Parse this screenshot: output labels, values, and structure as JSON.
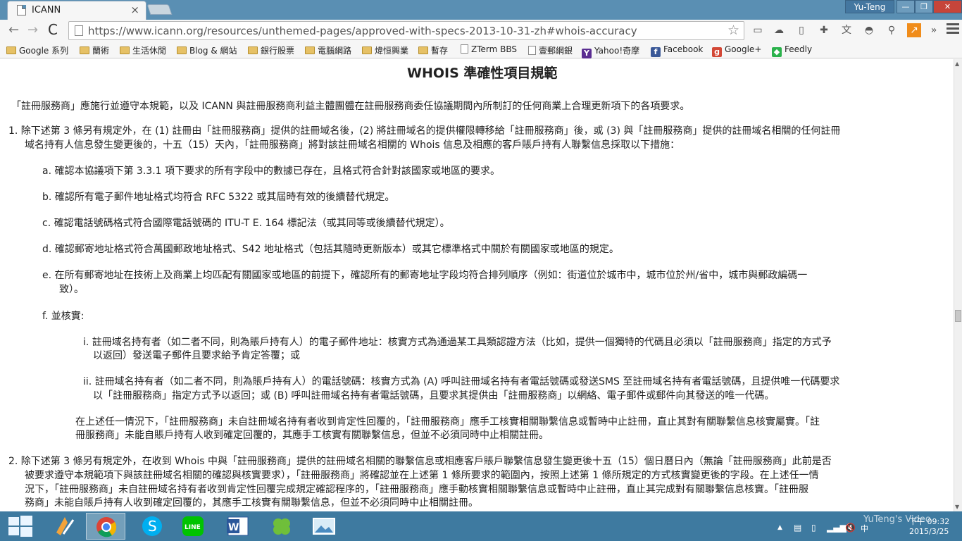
{
  "browser": {
    "tab_title": "ICANN",
    "tab_close": "×",
    "user_name": "Yu-Teng",
    "win_min": "—",
    "win_max": "❐",
    "win_close": "✕",
    "url": "https://www.icann.org/resources/unthemed-pages/approved-with-specs-2013-10-31-zh#whois-accuracy",
    "back": "←",
    "forward": "→",
    "reload": "C",
    "star": "☆"
  },
  "bookmarks": [
    {
      "label": "Google 系列",
      "kind": "folder"
    },
    {
      "label": "蘭術",
      "kind": "folder"
    },
    {
      "label": "生活休閒",
      "kind": "folder"
    },
    {
      "label": "Blog & 網站",
      "kind": "folder"
    },
    {
      "label": "銀行股票",
      "kind": "folder"
    },
    {
      "label": "電腦網路",
      "kind": "folder"
    },
    {
      "label": "煒恒興業",
      "kind": "folder"
    },
    {
      "label": "暫存",
      "kind": "folder"
    },
    {
      "label": "ZTerm BBS",
      "kind": "page"
    },
    {
      "label": "壹郵網銀",
      "kind": "page"
    },
    {
      "label": "Yahoo!奇摩",
      "kind": "yahoo"
    },
    {
      "label": "Facebook",
      "kind": "facebook"
    },
    {
      "label": "Google+",
      "kind": "gplus"
    },
    {
      "label": "Feedly",
      "kind": "feedly"
    }
  ],
  "page": {
    "title": "WHOIS 準確性項目規範",
    "intro": "「註冊服務商」應施行並遵守本規範，以及 ICANN 與註冊服務商利益主體團體在註冊服務商委任協議期間內所制訂的任何商業上合理更新項下的各項要求。",
    "item1_line1": "1. 除下述第 3 條另有規定外，在 (1) 註冊由「註冊服務商」提供的註冊域名後，(2) 將註冊域名的提供權限轉移給「註冊服務商」後，或 (3) 與「註冊服務商」提供的註冊域名相關的任何註冊",
    "item1_line2": "域名持有人信息發生變更後的，十五（15）天內，「註冊服務商」將對該註冊域名相關的 Whois 信息及相應的客戶賬戶持有人聯繫信息採取以下措施：",
    "item_a": "a. 確認本協議項下第 3.3.1 項下要求的所有字段中的數據已存在，且格式符合針對該國家或地區的要求。",
    "item_b": "b. 確認所有電子郵件地址格式均符合 RFC 5322 或其屆時有效的後續替代規定。",
    "item_c": "c. 確認電話號碼格式符合國際電話號碼的 ITU-T E. 164 標記法（或其同等或後續替代規定）。",
    "item_d": "d. 確認郵寄地址格式符合萬國郵政地址格式、S42 地址格式（包括其隨時更新版本）或其它標準格式中關於有關國家或地區的規定。",
    "item_e_line1": "e. 在所有郵寄地址在技術上及商業上均匹配有關國家或地區的前提下，確認所有的郵寄地址字段均符合排列順序（例如：街道位於城市中，城市位於州/省中，城市與郵政編碼一",
    "item_e_line2": "致）。",
    "item_f": "f. 並核實:",
    "item_fi_line1": "i. 註冊域名持有者（如二者不同，則為賬戶持有人）的電子郵件地址：核實方式為通過某工具類認證方法（比如，提供一個獨特的代碼且必須以「註冊服務商」指定的方式予",
    "item_fi_line2": "以返回）發送電子郵件且要求給予肯定答覆；或",
    "item_fii_line1": "ii. 註冊域名持有者（如二者不同，則為賬戶持有人）的電話號碼：核實方式為 (A) 呼叫註冊域名持有者電話號碼或發送SMS 至註冊域名持有者電話號碼，且提供唯一代碼要求",
    "item_fii_line2": "以「註冊服務商」指定方式予以返回；或 (B) 呼叫註冊域名持有者電話號碼，且要求其提供由「註冊服務商」以網絡、電子郵件或郵件向其發送的唯一代碼。",
    "para_f_line1": "在上述任一情況下，「註冊服務商」未自註冊域名持有者收到肯定性回覆的，「註冊服務商」應手工核實相關聯繫信息或暫時中止註冊，直止其對有關聯繫信息核實屬實。「註",
    "para_f_line2": "冊服務商」未能自賬戶持有人收到確定回覆的，其應手工核實有關聯繫信息，但並不必須同時中止相關註冊。",
    "item2_line1": "2. 除下述第 3 條另有規定外，在收到 Whois 中與「註冊服務商」提供的註冊域名相關的聯繫信息或相應客戶賬戶聯繫信息發生變更後十五（15）個日曆日內（無論「註冊服務商」此前是否",
    "item2_line2": "被要求遵守本規範項下與該註冊域名相關的確認與核實要求），「註冊服務商」將確認並在上述第 1 條所要求的範圍內，按照上述第 1 條所規定的方式核實變更後的字段。在上述任一情",
    "item2_line3": "況下，「註冊服務商」未自註冊域名持有者收到肯定性回覆完成規定確認程序的，「註冊服務商」應手動核實相關聯繫信息或暫時中止註冊，直止其完成對有關聯繫信息核實。「註冊服",
    "item2_line4": "務商」未能自賬戶持有人收到確定回覆的，其應手工核實有關聯繫信息，但並不必須同時中止相關註冊。"
  },
  "taskbar": {
    "time": "下午 09:32",
    "date": "2015/3/25",
    "watermark": "YuTeng's Video"
  },
  "colors": {
    "tabbar": "#5a8fb3",
    "taskbar": "#3e7aa0",
    "close_button": "#c6453a"
  }
}
